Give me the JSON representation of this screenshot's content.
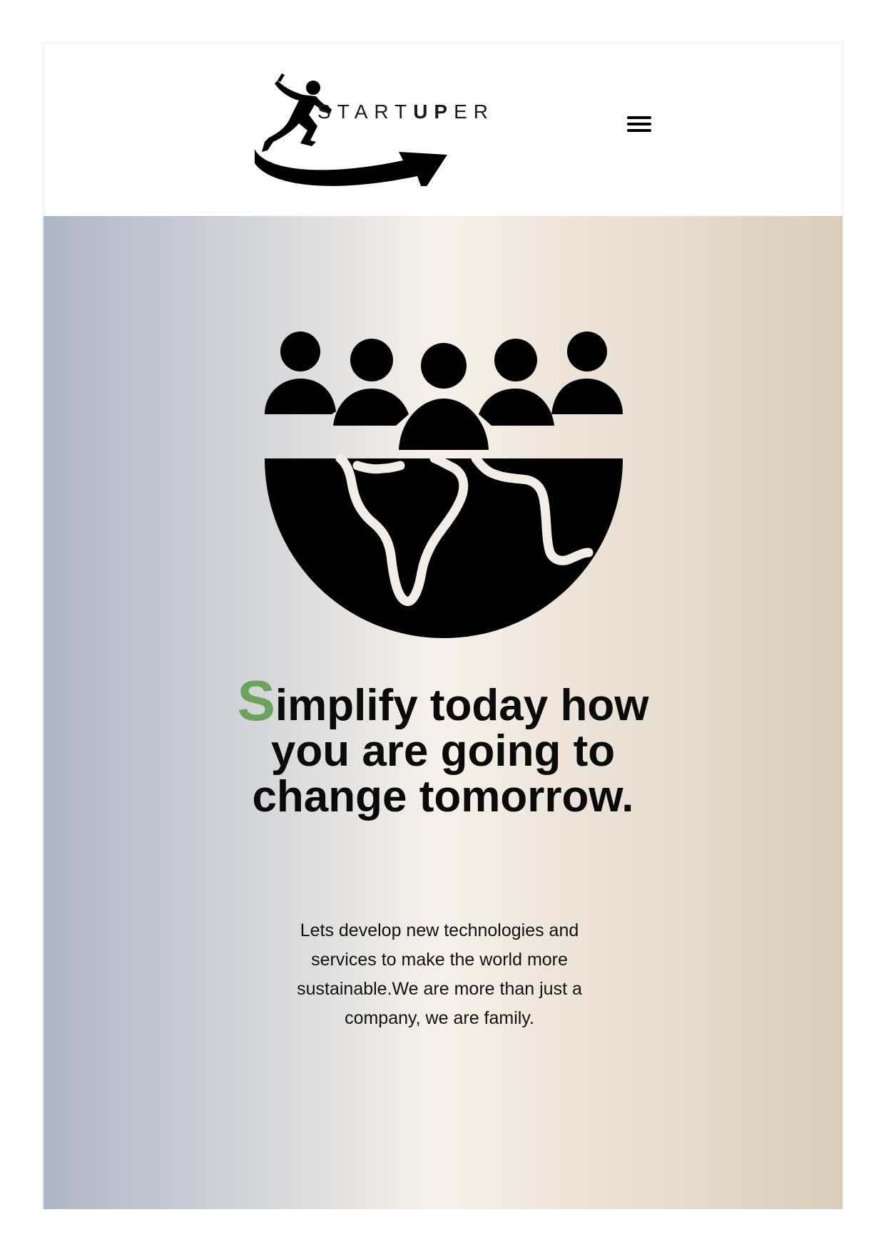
{
  "header": {
    "logo": {
      "text_part1": "START",
      "text_bold": "UP",
      "text_part2": "ER",
      "icon": "runner-arrow-logo"
    },
    "menu_icon": "hamburger-menu-icon"
  },
  "hero": {
    "illustration_icon": "people-globe-icon",
    "headline_initial": "S",
    "headline_rest": "implify today how you are going to change tomorrow.",
    "description": "Lets develop new technologies and services to make the world more sustainable.We are more than just a company, we are family.",
    "colors": {
      "accent": "#6aa35a",
      "gradient_left": "#aeb6c6",
      "gradient_center": "#f7f1ea",
      "gradient_right": "#d8ceba"
    }
  }
}
